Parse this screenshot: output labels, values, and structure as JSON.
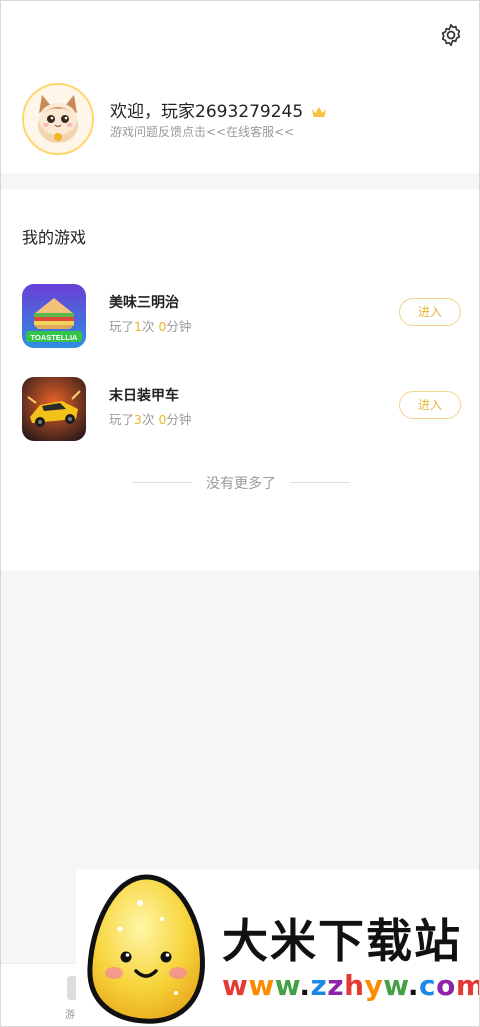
{
  "header": {
    "welcome_text": "欢迎，玩家2693279245",
    "feedback_text": "游戏问题反馈点击<<在线客服<<"
  },
  "games_section": {
    "title": "我的游戏",
    "items": [
      {
        "name": "美味三明治",
        "played_prefix": "玩了",
        "times": "1",
        "times_unit": "次",
        "minutes": "0",
        "minutes_unit": "分钟",
        "enter_label": "进入",
        "icon_text": "TOASTELLIA"
      },
      {
        "name": "末日装甲车",
        "played_prefix": "玩了",
        "times": "3",
        "times_unit": "次",
        "minutes": "0",
        "minutes_unit": "分钟",
        "enter_label": "进入"
      }
    ],
    "end_text": "没有更多了"
  },
  "bottom_tab": {
    "label": "游"
  },
  "watermark": {
    "title": "大米下载站",
    "url_parts": [
      {
        "text": "w",
        "color": "#e53935"
      },
      {
        "text": "w",
        "color": "#fb8c00"
      },
      {
        "text": "w",
        "color": "#43a047"
      },
      {
        "text": ".",
        "color": "#111111"
      },
      {
        "text": "z",
        "color": "#1e88e5"
      },
      {
        "text": "z",
        "color": "#8e24aa"
      },
      {
        "text": "h",
        "color": "#e53935"
      },
      {
        "text": "y",
        "color": "#fb8c00"
      },
      {
        "text": "w",
        "color": "#43a047"
      },
      {
        "text": ".",
        "color": "#111111"
      },
      {
        "text": "c",
        "color": "#1e88e5"
      },
      {
        "text": "o",
        "color": "#8e24aa"
      },
      {
        "text": "m",
        "color": "#e53935"
      }
    ]
  },
  "colors": {
    "accent": "#f0b429",
    "button_border": "#f1d58d",
    "muted": "#9a9a9a"
  }
}
